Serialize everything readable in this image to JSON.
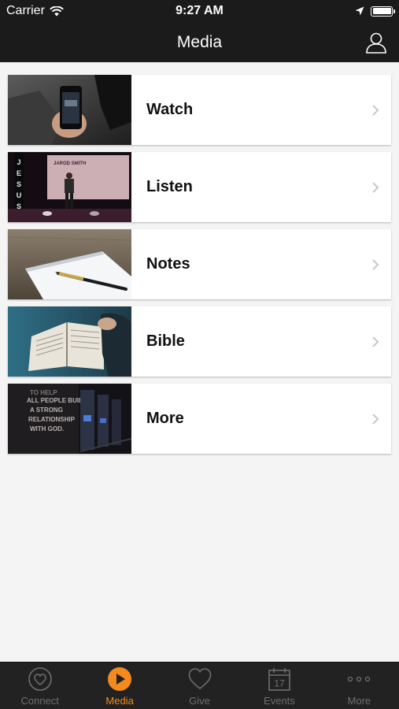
{
  "status": {
    "carrier": "Carrier",
    "time": "9:27 AM"
  },
  "header": {
    "title": "Media"
  },
  "items": [
    {
      "label": "Watch",
      "thumb_title": ""
    },
    {
      "label": "Listen",
      "thumb_title": "JAROD SMITH"
    },
    {
      "label": "Notes",
      "thumb_title": ""
    },
    {
      "label": "Bible",
      "thumb_title": ""
    },
    {
      "label": "More",
      "thumb_title": ""
    }
  ],
  "tabs": [
    {
      "label": "Connect",
      "icon": "heart-circle-icon"
    },
    {
      "label": "Media",
      "icon": "play-icon"
    },
    {
      "label": "Give",
      "icon": "heart-icon"
    },
    {
      "label": "Events",
      "icon": "calendar-icon",
      "day": "17"
    },
    {
      "label": "More",
      "icon": "ellipsis-icon"
    }
  ],
  "colors": {
    "accent": "#f28a1e",
    "bar": "#1b1b1b",
    "inactive": "#6f6f6f"
  }
}
